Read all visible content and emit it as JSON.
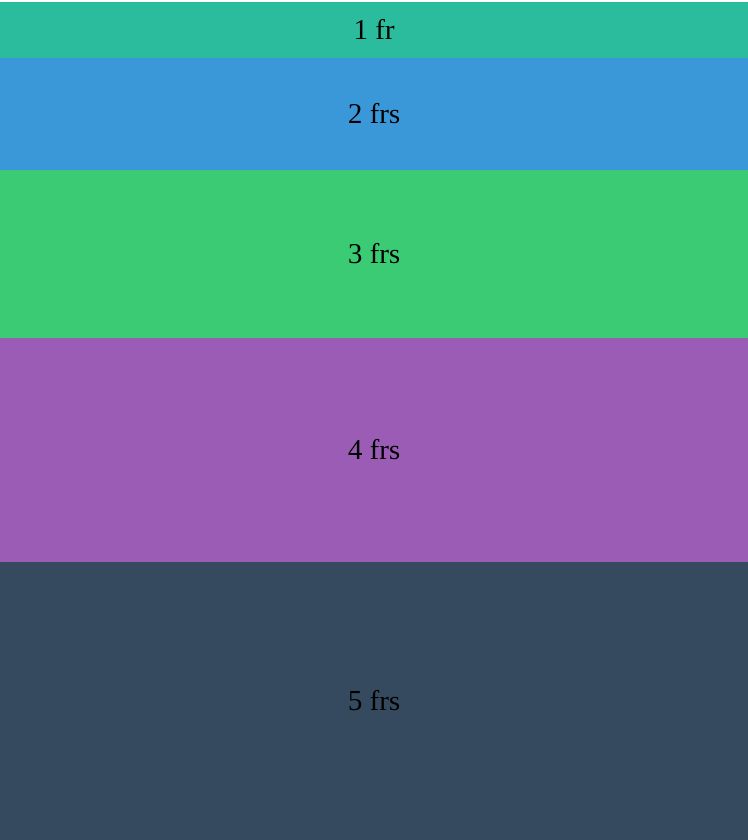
{
  "rows": [
    {
      "label": "1 fr",
      "fr": 1,
      "color": "#2abc9c"
    },
    {
      "label": "2 frs",
      "fr": 2,
      "color": "#3a98d9"
    },
    {
      "label": "3 frs",
      "fr": 3,
      "color": "#3acb74"
    },
    {
      "label": "4 frs",
      "fr": 4,
      "color": "#9a5cb5"
    },
    {
      "label": "5 frs",
      "fr": 5,
      "color": "#354a5f"
    }
  ]
}
